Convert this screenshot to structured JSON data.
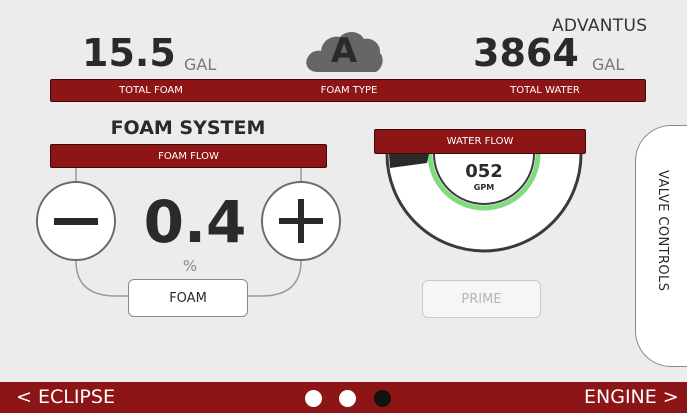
{
  "brand": "ADVANTUS",
  "foam": {
    "total": "15.5",
    "unit": "GAL",
    "label": "TOTAL FOAM"
  },
  "foam_type": {
    "letter": "A",
    "label": "FOAM TYPE",
    "icon": "cloud-icon"
  },
  "water": {
    "total": "3864",
    "unit": "GAL",
    "label": "TOTAL WATER"
  },
  "foam_system": {
    "title": "FOAM SYSTEM",
    "bar_label": "FOAM FLOW",
    "value": "0.4",
    "unit": "%",
    "mode_button": "FOAM",
    "decrease_icon": "minus-icon",
    "increase_icon": "plus-icon"
  },
  "water_flow": {
    "label": "WATER FLOW",
    "value": "052",
    "unit": "GPM",
    "prime_button": "PRIME"
  },
  "valve_tab": {
    "label": "VALVE CONTROLS"
  },
  "nav": {
    "prev": "< ECLIPSE",
    "next": "ENGINE >",
    "page_count": 3,
    "active_page": 3
  },
  "colors": {
    "accent_red": "#8e1516",
    "background": "#ececec",
    "gauge_green": "#7fdc7f"
  }
}
